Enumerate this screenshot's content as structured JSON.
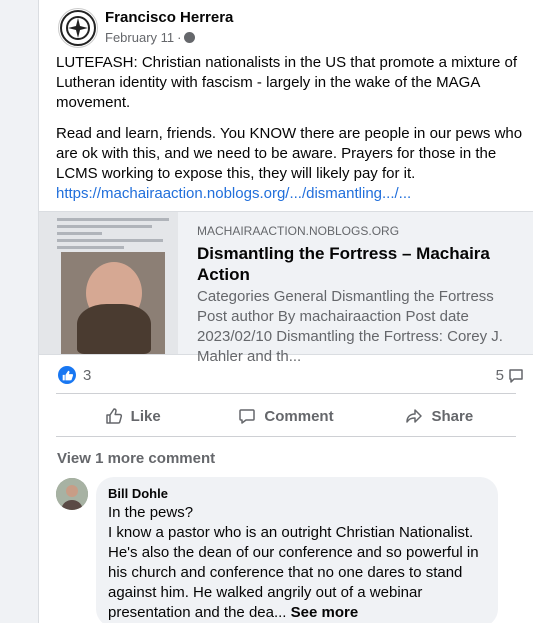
{
  "post": {
    "author": "Francisco Herrera",
    "date": "February 11",
    "separator": "·",
    "paragraph1": "LUTEFASH: Christian nationalists in the US that promote a mixture of Lutheran identity with fascism - largely in the wake of the MAGA movement.",
    "paragraph2": "Read and learn, friends. You KNOW there are people in our pews who are ok with this, and we need to be aware. Prayers for those in the LCMS working to expose this, they will likely pay for it.",
    "link": "https://machairaaction.noblogs.org/.../dismantling.../..."
  },
  "preview": {
    "domain": "MACHAIRAACTION.NOBLOGS.ORG",
    "title": "Dismantling the Fortress – Machaira Action",
    "description": "Categories General Dismantling the Fortress Post author By machairaaction Post date 2023/02/10 Dismantling the Fortress: Corey J. Mahler and th..."
  },
  "stats": {
    "reaction_count": "3",
    "comment_count": "5"
  },
  "actions": {
    "like": "Like",
    "comment": "Comment",
    "share": "Share"
  },
  "view_more": "View 1 more comment",
  "comment": {
    "author": "Bill Dohle",
    "text": "In the pews?\nI know a pastor who is an outright Christian Nationalist. He's also the dean of our conference and so powerful in his church and conference that no one dares to stand against him. He walked angrily out of a webinar presentation and the dea...",
    "see_more": "See more"
  },
  "colors": {
    "link": "#216fdb",
    "like_blue": "#1877f2",
    "secondary_text": "#65676b"
  }
}
